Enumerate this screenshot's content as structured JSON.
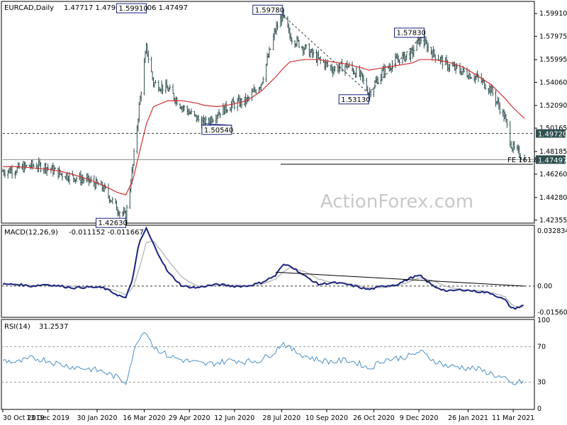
{
  "colors": {
    "price": "#2f4f4f",
    "ma": "#d32f2f",
    "macd": "#1a237e",
    "signal": "#a0a0a0",
    "rsi": "#4a90c8",
    "trend": "#000000",
    "frame": "#000000",
    "flag_bg": "#2f4f4f",
    "label_border": "#1a237e"
  },
  "watermark": "ActionForex.com",
  "header": {
    "title": "EURCAD,Daily",
    "ohlc": "1.47717 1.47986 1.47406 1.47497"
  },
  "price_axis": {
    "ticks": [
      "1.59910",
      "1.57975",
      "1.55995",
      "1.54060",
      "1.52090",
      "1.50165",
      "1.48185",
      "1.46260",
      "1.44280",
      "1.42355"
    ],
    "current_price": "1.47497",
    "level_flag": "1.49720"
  },
  "macd_header": {
    "name": "MACD(12,26,9)",
    "values": "-0.011152 -0.011667"
  },
  "macd_axis": {
    "top": "0.032834",
    "zero": "0.00",
    "bottom": "-0.015604"
  },
  "rsi_header": {
    "name": "RSI(14)",
    "value": "31.2537"
  },
  "rsi_axis": {
    "ticks": [
      "100",
      "70",
      "30",
      "0"
    ]
  },
  "x_axis": {
    "labels": [
      "30 Oct 2019",
      "13 Dec 2019",
      "30 Jan 2020",
      "16 Mar 2020",
      "29 Apr 2020",
      "12 Jun 2020",
      "28 Jul 2020",
      "10 Sep 2020",
      "26 Oct 2020",
      "9 Dec 2020",
      "26 Jan 2021",
      "11 Mar 2021"
    ]
  },
  "annotations": {
    "high_mar": "1.59910",
    "high_jul": "1.59780",
    "high_dec": "1.57830",
    "low_oct": "1.53130",
    "low_may": "1.50540",
    "low_feb": "1.42630",
    "fe_label": "FE 161.8"
  },
  "chart_data": [
    {
      "type": "bar",
      "title": "EURCAD,Daily",
      "legend": "none",
      "grid": false,
      "ylim": [
        1.4216,
        1.6088
      ],
      "x": [
        "2019-10-30",
        "2019-11-13",
        "2019-11-27",
        "2019-12-11",
        "2019-12-25",
        "2020-01-08",
        "2020-01-22",
        "2020-02-05",
        "2020-02-19",
        "2020-02-27",
        "2020-03-05",
        "2020-03-11",
        "2020-03-18",
        "2020-03-25",
        "2020-04-08",
        "2020-04-22",
        "2020-05-06",
        "2020-05-14",
        "2020-05-27",
        "2020-06-10",
        "2020-06-24",
        "2020-07-08",
        "2020-07-22",
        "2020-07-29",
        "2020-08-05",
        "2020-08-19",
        "2020-09-02",
        "2020-09-16",
        "2020-09-30",
        "2020-10-14",
        "2020-10-21",
        "2020-11-04",
        "2020-11-18",
        "2020-12-02",
        "2020-12-10",
        "2020-12-23",
        "2021-01-06",
        "2021-01-20",
        "2021-02-03",
        "2021-02-17",
        "2021-03-03",
        "2021-03-10",
        "2021-03-17",
        "2021-03-22"
      ],
      "series": [
        {
          "values": [
            1.465,
            1.467,
            1.47,
            1.469,
            1.463,
            1.46,
            1.457,
            1.451,
            1.433,
            1.4263,
            1.47,
            1.52,
            1.57,
            1.54,
            1.535,
            1.52,
            1.51,
            1.5054,
            1.515,
            1.522,
            1.525,
            1.54,
            1.585,
            1.5978,
            1.58,
            1.57,
            1.56,
            1.552,
            1.555,
            1.545,
            1.5313,
            1.55,
            1.56,
            1.565,
            1.5783,
            1.565,
            1.555,
            1.55,
            1.545,
            1.535,
            1.51,
            1.485,
            1.48,
            1.475
          ]
        },
        {
          "name": "MA",
          "values": [
            1.469,
            1.469,
            1.468,
            1.467,
            1.465,
            1.462,
            1.458,
            1.453,
            1.447,
            1.445,
            1.458,
            1.48,
            1.505,
            1.52,
            1.525,
            1.525,
            1.523,
            1.521,
            1.52,
            1.522,
            1.525,
            1.533,
            1.545,
            1.552,
            1.558,
            1.56,
            1.56,
            1.558,
            1.556,
            1.553,
            1.551,
            1.553,
            1.555,
            1.557,
            1.56,
            1.56,
            1.558,
            1.554,
            1.547,
            1.539,
            1.527,
            1.52,
            1.514,
            1.51
          ]
        }
      ]
    },
    {
      "type": "line",
      "title": "MACD(12,26,9)",
      "legend": "none",
      "grid": false,
      "ylim": [
        -0.0175,
        0.0345
      ],
      "x": [
        "2019-10-30",
        "2019-11-13",
        "2019-11-27",
        "2019-12-11",
        "2019-12-25",
        "2020-01-08",
        "2020-01-22",
        "2020-02-05",
        "2020-02-19",
        "2020-02-27",
        "2020-03-05",
        "2020-03-11",
        "2020-03-18",
        "2020-03-25",
        "2020-04-08",
        "2020-04-22",
        "2020-05-06",
        "2020-05-14",
        "2020-05-27",
        "2020-06-10",
        "2020-06-24",
        "2020-07-08",
        "2020-07-22",
        "2020-07-29",
        "2020-08-05",
        "2020-08-19",
        "2020-09-02",
        "2020-09-16",
        "2020-09-30",
        "2020-10-14",
        "2020-10-21",
        "2020-11-04",
        "2020-11-18",
        "2020-12-02",
        "2020-12-10",
        "2020-12-23",
        "2021-01-06",
        "2021-01-20",
        "2021-02-03",
        "2021-02-17",
        "2021-03-03",
        "2021-03-10",
        "2021-03-17",
        "2021-03-22"
      ],
      "series": [
        {
          "values": [
            0.001,
            0.001,
            0.0,
            0.001,
            0.0,
            -0.001,
            -0.0005,
            -0.001,
            -0.005,
            -0.007,
            0.005,
            0.025,
            0.033,
            0.024,
            0.008,
            0.0,
            -0.001,
            0.0,
            0.001,
            0.0,
            0.0,
            0.002,
            0.006,
            0.012,
            0.012,
            0.006,
            0.001,
            0.002,
            0.001,
            -0.001,
            -0.002,
            0.0,
            0.001,
            0.005,
            0.006,
            0.0,
            -0.003,
            -0.002,
            -0.003,
            -0.004,
            -0.008,
            -0.013,
            -0.012,
            -0.011
          ]
        },
        {
          "values": [
            0.001,
            0.001,
            0.0005,
            0.0005,
            0.0003,
            0.0,
            -0.0005,
            -0.0008,
            -0.003,
            -0.005,
            -0.001,
            0.01,
            0.025,
            0.026,
            0.015,
            0.005,
            0.0,
            0.0,
            0.0005,
            0.0005,
            0.0003,
            0.001,
            0.004,
            0.008,
            0.0105,
            0.0085,
            0.004,
            0.002,
            0.0015,
            0.0,
            -0.001,
            -0.0008,
            0.0,
            0.003,
            0.005,
            0.003,
            -0.0005,
            -0.002,
            -0.0025,
            -0.0035,
            -0.006,
            -0.011,
            -0.012,
            -0.0117
          ]
        },
        {
          "name": "trend",
          "values": [
            null,
            null,
            null,
            null,
            null,
            null,
            null,
            null,
            null,
            null,
            null,
            null,
            null,
            null,
            null,
            null,
            null,
            null,
            null,
            null,
            null,
            null,
            0.008,
            null,
            null,
            null,
            null,
            null,
            null,
            null,
            null,
            null,
            null,
            null,
            null,
            null,
            null,
            null,
            null,
            null,
            null,
            null,
            null,
            0.0
          ]
        }
      ]
    },
    {
      "type": "line",
      "title": "RSI(14)",
      "legend": "none",
      "grid": false,
      "ylim": [
        0,
        100
      ],
      "x": [
        "2019-10-30",
        "2019-11-13",
        "2019-11-27",
        "2019-12-11",
        "2019-12-25",
        "2020-01-08",
        "2020-01-22",
        "2020-02-05",
        "2020-02-19",
        "2020-02-27",
        "2020-03-05",
        "2020-03-11",
        "2020-03-18",
        "2020-03-25",
        "2020-04-08",
        "2020-04-22",
        "2020-05-06",
        "2020-05-14",
        "2020-05-27",
        "2020-06-10",
        "2020-06-24",
        "2020-07-08",
        "2020-07-22",
        "2020-07-29",
        "2020-08-05",
        "2020-08-19",
        "2020-09-02",
        "2020-09-16",
        "2020-09-30",
        "2020-10-14",
        "2020-10-21",
        "2020-11-04",
        "2020-11-18",
        "2020-12-02",
        "2020-12-10",
        "2020-12-23",
        "2021-01-06",
        "2021-01-20",
        "2021-02-03",
        "2021-02-17",
        "2021-03-03",
        "2021-03-10",
        "2021-03-17",
        "2021-03-22"
      ],
      "series": [
        {
          "values": [
            55,
            52,
            57,
            55,
            50,
            47,
            45,
            42,
            35,
            30,
            60,
            82,
            88,
            70,
            60,
            55,
            52,
            50,
            52,
            55,
            53,
            55,
            65,
            75,
            68,
            60,
            55,
            53,
            55,
            50,
            45,
            55,
            57,
            60,
            65,
            55,
            48,
            47,
            45,
            40,
            33,
            27,
            30,
            31
          ]
        }
      ],
      "levels": [
        70,
        30
      ]
    }
  ]
}
